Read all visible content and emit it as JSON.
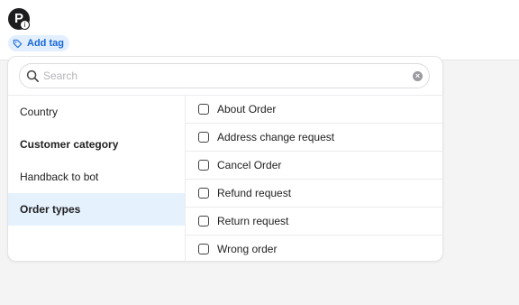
{
  "header": {
    "avatar_letter": "P",
    "avatar_badge": "i",
    "add_tag_label": "Add tag",
    "add_tag_icon": "tag-icon"
  },
  "search": {
    "placeholder": "Search",
    "value": "",
    "icon": "search-icon",
    "clear_icon": "clear-icon"
  },
  "categories": [
    {
      "label": "Country",
      "bold": false,
      "selected": false
    },
    {
      "label": "Customer category",
      "bold": true,
      "selected": false
    },
    {
      "label": "Handback to bot",
      "bold": false,
      "selected": false
    },
    {
      "label": "Order types",
      "bold": true,
      "selected": true
    }
  ],
  "options": [
    {
      "label": "About Order",
      "checked": false
    },
    {
      "label": "Address change request",
      "checked": false
    },
    {
      "label": "Cancel Order",
      "checked": false
    },
    {
      "label": "Refund request",
      "checked": false
    },
    {
      "label": "Return request",
      "checked": false
    },
    {
      "label": "Wrong order",
      "checked": false
    }
  ],
  "colors": {
    "accent": "#1667d9",
    "tag_bg": "#e3efff",
    "selected_bg": "#e5f1fd"
  }
}
